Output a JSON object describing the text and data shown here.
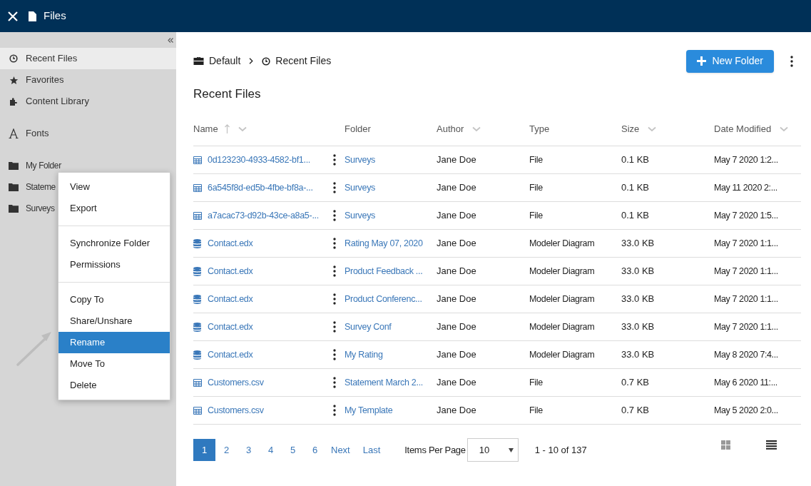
{
  "header": {
    "title": "Files"
  },
  "sidebar": {
    "items": [
      {
        "label": "Recent Files",
        "kind": "clock",
        "selected": true
      },
      {
        "label": "Favorites",
        "kind": "star",
        "selected": false
      },
      {
        "label": "Content Library",
        "kind": "puzzle",
        "selected": false
      },
      {
        "label": "Fonts",
        "kind": "font",
        "selected": false
      },
      {
        "label": "My Folder",
        "kind": "folder",
        "selected": false
      },
      {
        "label": "Stateme",
        "kind": "folder",
        "selected": false
      },
      {
        "label": "Surveys",
        "kind": "folder",
        "selected": false
      }
    ]
  },
  "context_menu": {
    "groups": [
      [
        {
          "label": "View",
          "selected": false
        },
        {
          "label": "Export",
          "selected": false
        }
      ],
      [
        {
          "label": "Synchronize Folder",
          "selected": false
        },
        {
          "label": "Permissions",
          "selected": false
        }
      ],
      [
        {
          "label": "Copy To",
          "selected": false
        },
        {
          "label": "Share/Unshare",
          "selected": false
        },
        {
          "label": "Rename",
          "selected": true
        },
        {
          "label": "Move To",
          "selected": false
        },
        {
          "label": "Delete",
          "selected": false
        }
      ]
    ]
  },
  "breadcrumb": [
    {
      "label": "Default",
      "kind": "briefcase"
    },
    {
      "label": "Recent Files",
      "kind": "clock"
    }
  ],
  "new_folder_button": "New Folder",
  "page_title": "Recent Files",
  "table": {
    "columns": [
      {
        "label": "Name",
        "sorted": true,
        "menu": true
      },
      {
        "label": "Folder",
        "sorted": false,
        "menu": false
      },
      {
        "label": "Author",
        "sorted": false,
        "menu": true
      },
      {
        "label": "Type",
        "sorted": false,
        "menu": false
      },
      {
        "label": "Size",
        "sorted": false,
        "menu": true
      },
      {
        "label": "Date Modified",
        "sorted": false,
        "menu": true
      }
    ],
    "rows": [
      {
        "kind": "table",
        "name": "0d123230-4933-4582-bf1...",
        "folder": "Surveys",
        "author": "Jane Doe",
        "type": "File",
        "size": "0.1 KB",
        "date": "May 7 2020 1:2..."
      },
      {
        "kind": "table",
        "name": "6a545f8d-ed5b-4fbe-bf8a-...",
        "folder": "Surveys",
        "author": "Jane Doe",
        "type": "File",
        "size": "0.1 KB",
        "date": "May 11 2020 2:..."
      },
      {
        "kind": "table",
        "name": "a7acac73-d92b-43ce-a8a5-...",
        "folder": "Surveys",
        "author": "Jane Doe",
        "type": "File",
        "size": "0.1 KB",
        "date": "May 7 2020 1:5..."
      },
      {
        "kind": "database",
        "name": "Contact.edx",
        "folder": "Rating May 07, 2020",
        "author": "Jane Doe",
        "type": "Modeler Diagram",
        "size": "33.0 KB",
        "date": "May 7 2020 1:1..."
      },
      {
        "kind": "database",
        "name": "Contact.edx",
        "folder": "Product Feedback ...",
        "author": "Jane Doe",
        "type": "Modeler Diagram",
        "size": "33.0 KB",
        "date": "May 7 2020 1:1..."
      },
      {
        "kind": "database",
        "name": "Contact.edx",
        "folder": "Product Conferenc...",
        "author": "Jane Doe",
        "type": "Modeler Diagram",
        "size": "33.0 KB",
        "date": "May 7 2020 1:1..."
      },
      {
        "kind": "database",
        "name": "Contact.edx",
        "folder": "Survey Conf",
        "author": "Jane Doe",
        "type": "Modeler Diagram",
        "size": "33.0 KB",
        "date": "May 7 2020 1:1..."
      },
      {
        "kind": "database",
        "name": "Contact.edx",
        "folder": "My Rating",
        "author": "Jane Doe",
        "type": "Modeler Diagram",
        "size": "33.0 KB",
        "date": "May 8 2020 7:4..."
      },
      {
        "kind": "table",
        "name": "Customers.csv",
        "folder": "Statement March 2...",
        "author": "Jane Doe",
        "type": "File",
        "size": "0.7 KB",
        "date": "May 6 2020 11:..."
      },
      {
        "kind": "table",
        "name": "Customers.csv",
        "folder": "My Template",
        "author": "Jane Doe",
        "type": "File",
        "size": "0.7 KB",
        "date": "May 5 2020 2:0..."
      }
    ]
  },
  "pagination": {
    "pages": [
      {
        "label": "1",
        "selected": true
      },
      {
        "label": "2",
        "selected": false
      },
      {
        "label": "3",
        "selected": false
      },
      {
        "label": "4",
        "selected": false
      },
      {
        "label": "5",
        "selected": false
      },
      {
        "label": "6",
        "selected": false
      }
    ],
    "next": "Next",
    "last": "Last",
    "items_per_page_label": "Items Per Page",
    "items_per_page": "10",
    "range": "1 - 10 of 137"
  },
  "views": [
    {
      "kind": "grid",
      "selected": false
    },
    {
      "kind": "list",
      "selected": true
    }
  ]
}
